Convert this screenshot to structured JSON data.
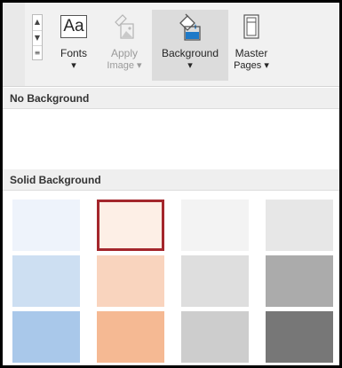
{
  "ribbon": {
    "fonts_label": "Fonts",
    "fonts_icon_text": "Aa",
    "apply_image_line1": "Apply",
    "apply_image_line2": "Image",
    "background_label": "Background",
    "master_pages_line1": "Master",
    "master_pages_line2": "Pages",
    "dropdown_glyph": "▾"
  },
  "gallery": {
    "no_background_header": "No Background",
    "solid_background_header": "Solid Background",
    "selected_index": 1,
    "swatch_rows": [
      [
        "#eef3fb",
        "#fdefe6",
        "#f3f3f3",
        "#e7e7e7"
      ],
      [
        "#cddff2",
        "#f9d4be",
        "#dedede",
        "#ababab"
      ],
      [
        "#a9c8ea",
        "#f5b993",
        "#cdcdcd",
        "#777777"
      ]
    ]
  }
}
